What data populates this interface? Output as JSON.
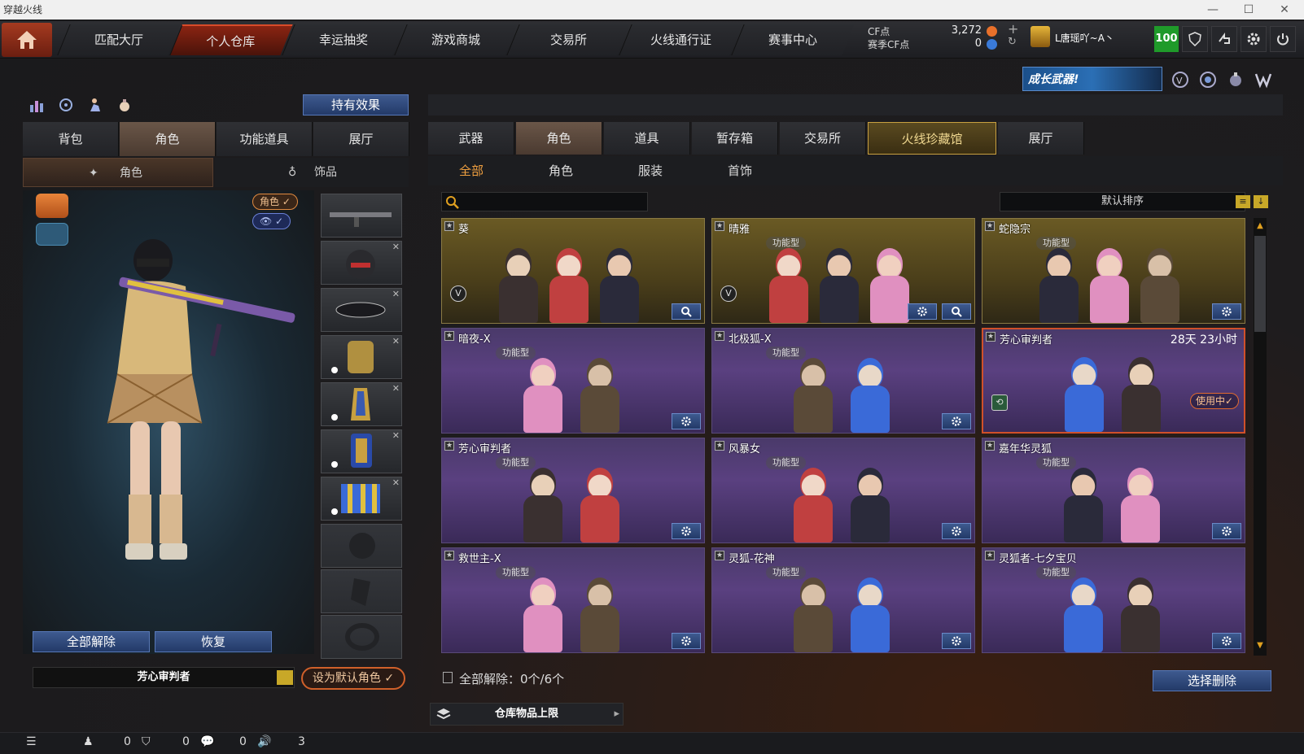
{
  "window": {
    "title": "穿越火线",
    "min": "—",
    "max": "☐",
    "close": "✕"
  },
  "nav": {
    "tabs": [
      "匹配大厅",
      "个人仓库",
      "幸运抽奖",
      "游戏商城",
      "交易所",
      "火线通行证",
      "赛事中心"
    ],
    "active_index": 1
  },
  "currency": {
    "cf_label": "CF点",
    "cf_value": "3,272",
    "season_label": "赛季CF点",
    "season_value": "0"
  },
  "user": {
    "name": "L唐瑶吖~A丶",
    "level": "100"
  },
  "promo": {
    "text": "成长武器!"
  },
  "left": {
    "effect_btn": "持有效果",
    "tabs": [
      "背包",
      "角色",
      "功能道具",
      "展厅"
    ],
    "active_tab": 1,
    "subtabs": [
      "角色",
      "饰品"
    ],
    "badge_role": "角色 ✓",
    "badge_eye": "👁 ✓",
    "btn_release_all": "全部解除",
    "btn_restore": "恢复",
    "character_name": "芳心审判者",
    "btn_set_default": "设为默认角色 ✓"
  },
  "right": {
    "tabs": [
      "武器",
      "角色",
      "道具",
      "暂存箱",
      "交易所",
      "火线珍藏馆",
      "展厅"
    ],
    "active_tab": 1,
    "special_tab": 5,
    "subtabs": [
      "全部",
      "角色",
      "服装",
      "首饰"
    ],
    "active_sub": 0,
    "search_placeholder": "",
    "sort_label": "默认排序",
    "cards": [
      {
        "name": "葵",
        "tag": "",
        "style": "gold",
        "time": "",
        "in_use": ""
      },
      {
        "name": "晴雅",
        "tag": "功能型",
        "style": "gold",
        "time": "",
        "in_use": ""
      },
      {
        "name": "蛇隐宗",
        "tag": "功能型",
        "style": "gold",
        "time": "",
        "in_use": ""
      },
      {
        "name": "暗夜-X",
        "tag": "功能型",
        "style": "purple",
        "time": "",
        "in_use": ""
      },
      {
        "name": "北极狐-X",
        "tag": "功能型",
        "style": "purple",
        "time": "",
        "in_use": ""
      },
      {
        "name": "芳心审判者",
        "tag": "",
        "style": "purple",
        "time": "28天 23小时",
        "in_use": "使用中✓"
      },
      {
        "name": "芳心审判者",
        "tag": "功能型",
        "style": "purple",
        "time": "",
        "in_use": ""
      },
      {
        "name": "风暴女",
        "tag": "功能型",
        "style": "purple",
        "time": "",
        "in_use": ""
      },
      {
        "name": "嘉年华灵狐",
        "tag": "功能型",
        "style": "purple",
        "time": "",
        "in_use": ""
      },
      {
        "name": "救世主-X",
        "tag": "功能型",
        "style": "purple",
        "time": "",
        "in_use": ""
      },
      {
        "name": "灵狐-花神",
        "tag": "功能型",
        "style": "purple",
        "time": "",
        "in_use": ""
      },
      {
        "name": "灵狐者-七夕宝贝",
        "tag": "功能型",
        "style": "purple",
        "time": "",
        "in_use": ""
      }
    ],
    "release_label": "全部解除：0个/6个",
    "btn_select_delete": "选择删除",
    "capacity_label": "仓库物品上限"
  },
  "status": {
    "count1": "0",
    "count2": "0",
    "count3": "0",
    "count4": "3"
  }
}
